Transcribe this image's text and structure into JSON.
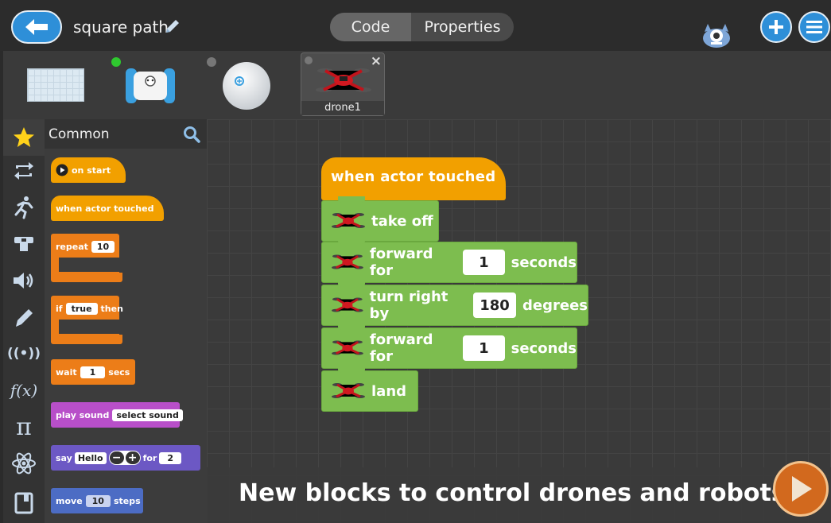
{
  "topbar": {
    "project_title": "square path",
    "tabs": [
      {
        "label": "Code",
        "active": true
      },
      {
        "label": "Properties",
        "active": false
      }
    ]
  },
  "actors": [
    {
      "icon": "stage-icon"
    },
    {
      "icon": "ollie-robot-icon",
      "status_color": "#2fc82f"
    },
    {
      "icon": "sphero-robot-icon",
      "status_color": "#777777"
    },
    {
      "icon": "drone-icon",
      "label": "drone1",
      "selected": true
    }
  ],
  "palette": {
    "title": "Common",
    "blocks": {
      "on_start": "on start",
      "when_touched": "when actor touched",
      "repeat": {
        "label": "repeat",
        "value": "10"
      },
      "if": {
        "label": "if",
        "value": "true",
        "then": "then"
      },
      "wait": {
        "label": "wait",
        "value": "1",
        "unit": "secs"
      },
      "play_sound": {
        "label": "play sound",
        "value": "select sound"
      },
      "say": {
        "label": "say",
        "value": "Hello",
        "for": "for",
        "count": "2"
      },
      "move": {
        "label": "move",
        "value": "10",
        "unit": "steps"
      }
    }
  },
  "categories": [
    "star-icon",
    "loop-icon",
    "motion-icon",
    "looks-icon",
    "sound-icon",
    "pen-icon",
    "broadcast-icon",
    "function-icon",
    "pi-icon",
    "atom-icon",
    "book-icon"
  ],
  "script": {
    "hat": "when actor touched",
    "blocks": [
      {
        "text": "take off"
      },
      {
        "text": "forward for",
        "value": "1",
        "unit": "seconds"
      },
      {
        "text": "turn right by",
        "value": "180",
        "unit": "degrees"
      },
      {
        "text": "forward for",
        "value": "1",
        "unit": "seconds"
      },
      {
        "text": "land"
      }
    ]
  },
  "caption": "New blocks to control drones and robots",
  "colors": {
    "events": "#f2a000",
    "control": "#ec7d18",
    "drone": "#7dbd4f",
    "sound": "#b84fc9",
    "looks": "#6c58c4",
    "motion": "#4c6cc4",
    "accent": "#2e8fd8"
  }
}
